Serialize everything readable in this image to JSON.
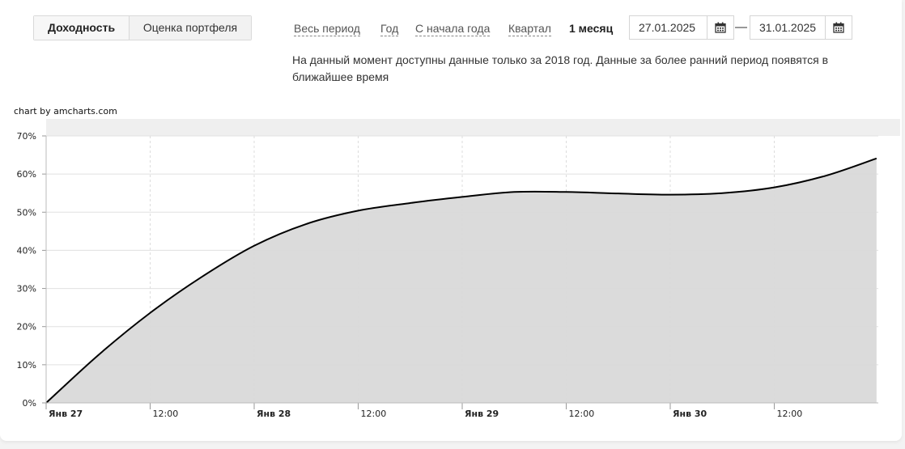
{
  "tabs": [
    {
      "label": "Доходность",
      "active": true
    },
    {
      "label": "Оценка портфеля",
      "active": false
    }
  ],
  "periods": [
    {
      "label": "Весь период",
      "active": false
    },
    {
      "label": "Год",
      "active": false
    },
    {
      "label": "С начала года",
      "active": false
    },
    {
      "label": "Квартал",
      "active": false
    },
    {
      "label": "1 месяц",
      "active": true
    }
  ],
  "date_range": {
    "from": "27.01.2025",
    "to": "31.01.2025",
    "separator": "—",
    "icon": "calendar-icon"
  },
  "notice": "На данный момент доступны данные только за 2018 год. Данные за более ранний период появятся в ближайшее время",
  "chart_credit": "chart by amcharts.com",
  "colors": {
    "fill": "#d9d9d9",
    "line": "#000000",
    "scrollbar": "#efefef",
    "grid": "#e0e0e0"
  },
  "chart_data": {
    "type": "area",
    "title": "",
    "xlabel": "",
    "ylabel": "",
    "ylim": [
      0,
      70
    ],
    "y_ticks": [
      "0%",
      "10%",
      "20%",
      "30%",
      "40%",
      "50%",
      "60%",
      "70%"
    ],
    "x_ticks": [
      {
        "label": "Янв 27",
        "bold": true
      },
      {
        "label": "12:00",
        "bold": false
      },
      {
        "label": "Янв 28",
        "bold": true
      },
      {
        "label": "12:00",
        "bold": false
      },
      {
        "label": "Янв 29",
        "bold": true
      },
      {
        "label": "12:00",
        "bold": false
      },
      {
        "label": "Янв 30",
        "bold": true
      },
      {
        "label": "12:00",
        "bold": false
      }
    ],
    "x_unit": "hours from Янв 27 00:00",
    "x": [
      0,
      6,
      12,
      18,
      24,
      30,
      36,
      42,
      48,
      54,
      60,
      66,
      72,
      78,
      84,
      90,
      95.8
    ],
    "y": [
      0,
      12.5,
      23.6,
      33.1,
      41.2,
      46.9,
      50.4,
      52.4,
      54.0,
      55.3,
      55.3,
      54.9,
      54.6,
      55.0,
      56.5,
      59.6,
      64.1
    ],
    "grid": true,
    "legend": "none"
  }
}
